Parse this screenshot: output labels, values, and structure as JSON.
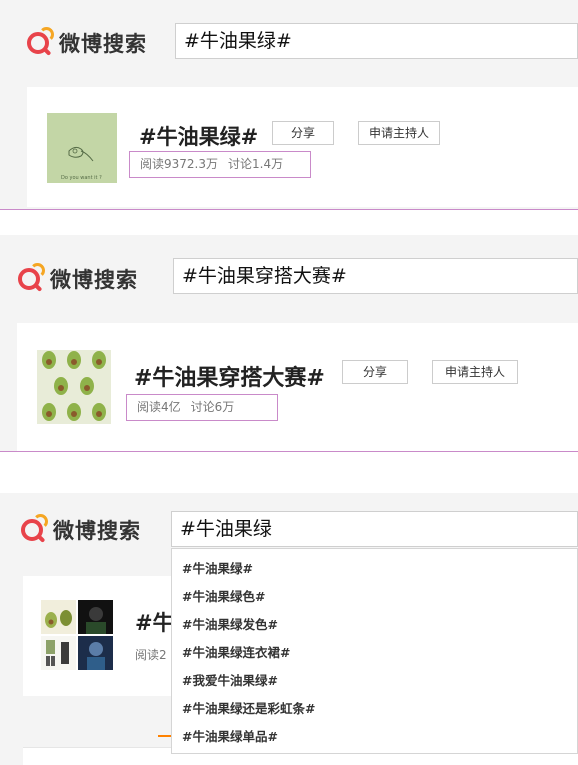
{
  "panels": [
    {
      "logo_text": "微博搜索",
      "search_value": "#牛油果绿#",
      "topic_title": "#牛油果绿#",
      "share_label": "分享",
      "host_label": "申请主持人",
      "reads": "阅读9372.3万",
      "discussions": "讨论1.4万",
      "avatar_caption": "Do you want it ?"
    },
    {
      "logo_text": "微博搜索",
      "search_value": "#牛油果穿搭大赛#",
      "topic_title": "#牛油果穿搭大赛#",
      "share_label": "分享",
      "host_label": "申请主持人",
      "reads": "阅读4亿",
      "discussions": "讨论6万"
    },
    {
      "logo_text": "微博搜索",
      "search_value": "#牛油果绿",
      "topic_title_partial": "#牛",
      "reads_partial": "阅读2"
    }
  ],
  "suggestions": [
    "#牛油果绿#",
    "#牛油果绿色#",
    "#牛油果绿发色#",
    "#牛油果绿连衣裙#",
    "#我爱牛油果绿#",
    "#牛油果绿还是彩虹条#",
    "#牛油果绿单品#"
  ],
  "colors": {
    "logo_red": "#e8434a",
    "logo_orange": "#f5a623",
    "highlight_border": "#c98ac9",
    "tab_active": "#ff8200"
  }
}
